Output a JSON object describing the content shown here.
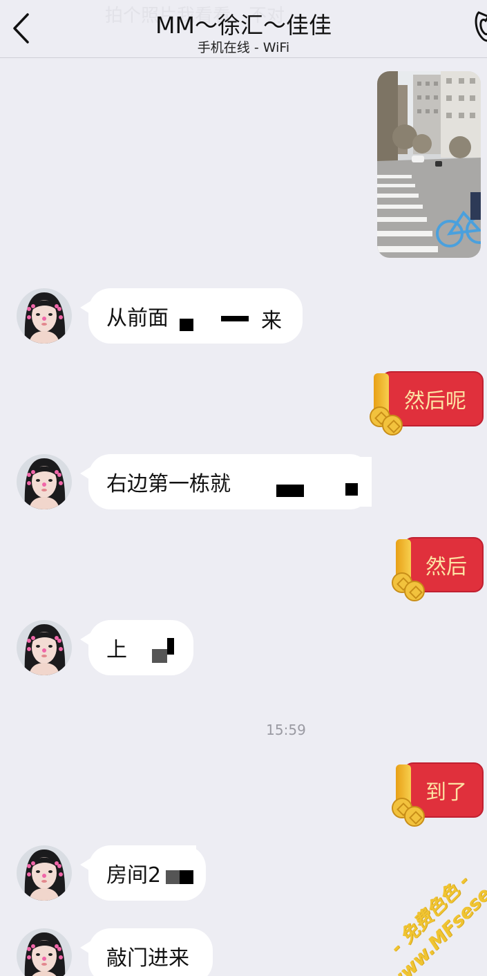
{
  "header": {
    "ghost_text": "拍个照片我看看，不对",
    "title": "MM～徐汇～佳佳",
    "subtitle": "手机在线 - WiFi"
  },
  "icons": {
    "back": "chevron-left-icon",
    "call": "phone-icon",
    "coin": "coin-icon"
  },
  "colors": {
    "background": "#ededf3",
    "incoming_bubble": "#ffffff",
    "red_packet": "#e0303c",
    "red_packet_text": "#fde3a4"
  },
  "messages": [
    {
      "type": "image",
      "side": "out"
    },
    {
      "type": "text",
      "side": "in",
      "text": "从前面",
      "tail": "来"
    },
    {
      "type": "red_packet",
      "side": "out",
      "text": "然后呢"
    },
    {
      "type": "text",
      "side": "in",
      "text": "右边第一栋就"
    },
    {
      "type": "red_packet",
      "side": "out",
      "text": "然后"
    },
    {
      "type": "text",
      "side": "in",
      "text": "上"
    },
    {
      "type": "timestamp",
      "text": "15:59"
    },
    {
      "type": "red_packet",
      "side": "out",
      "text": "到了"
    },
    {
      "type": "text",
      "side": "in",
      "text": "房间2"
    },
    {
      "type": "text",
      "side": "in",
      "text": "敲门进来"
    }
  ],
  "watermark": {
    "line1": "- 免费色色 -",
    "line2": "www.MFsese.com"
  }
}
